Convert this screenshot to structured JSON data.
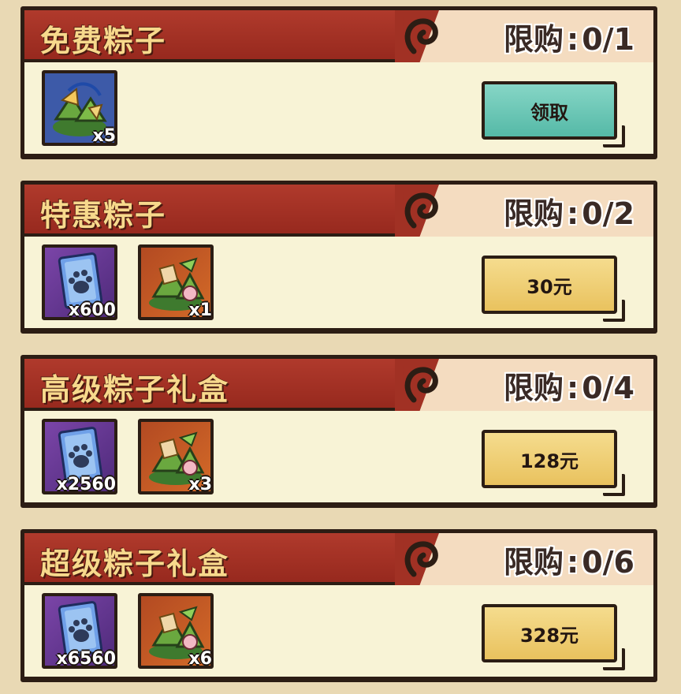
{
  "offers": [
    {
      "title": "免费粽子",
      "limit_label": "限购",
      "limit_value": "0/1",
      "button_label": "领取",
      "button_style": "teal",
      "items": [
        {
          "icon": "zongzi-pile-icon",
          "count": "x5",
          "style": "green"
        }
      ]
    },
    {
      "title": "特惠粽子",
      "limit_label": "限购",
      "limit_value": "0/2",
      "button_label": "30元",
      "button_style": "gold",
      "items": [
        {
          "icon": "paw-card-icon",
          "count": "x600",
          "style": "card-purple"
        },
        {
          "icon": "zongzi-bundle-icon",
          "count": "x1",
          "style": "dumpling-red"
        }
      ]
    },
    {
      "title": "高级粽子礼盒",
      "limit_label": "限购",
      "limit_value": "0/4",
      "button_label": "128元",
      "button_style": "gold",
      "items": [
        {
          "icon": "paw-card-icon",
          "count": "x2560",
          "style": "card-purple"
        },
        {
          "icon": "zongzi-bundle-icon",
          "count": "x3",
          "style": "dumpling-red"
        }
      ]
    },
    {
      "title": "超级粽子礼盒",
      "limit_label": "限购",
      "limit_value": "0/6",
      "button_label": "328元",
      "button_style": "gold",
      "items": [
        {
          "icon": "paw-card-icon",
          "count": "x6560",
          "style": "card-purple"
        },
        {
          "icon": "zongzi-bundle-icon",
          "count": "x6",
          "style": "dumpling-red"
        }
      ]
    }
  ],
  "colors": {
    "ribbon": "#a13124",
    "title_text": "#f7d98c",
    "card_bg": "#f8f3d6",
    "header_bg": "#f4dcc0",
    "teal_button": "#6cc8b6",
    "gold_button": "#efcf76",
    "border": "#2c1d14"
  }
}
